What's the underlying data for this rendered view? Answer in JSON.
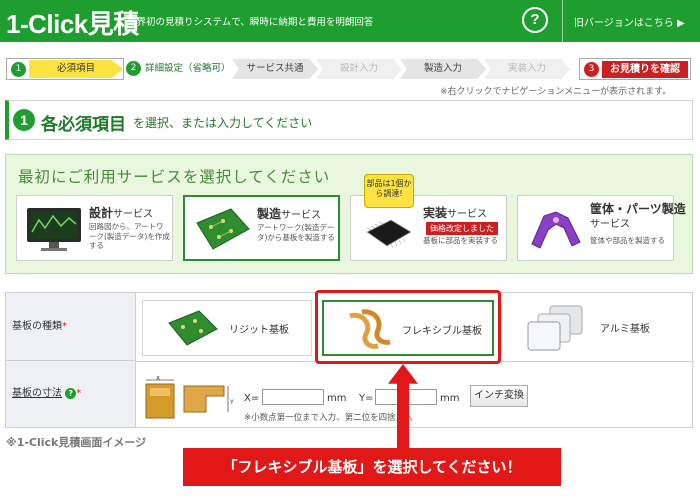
{
  "header": {
    "logo": "1-Click見積",
    "tagline": "業界初の見積りシステムで、瞬時に納期と費用を明朗回答",
    "help_label": "?",
    "old_version_link": "旧バージョンはこちら ▶"
  },
  "steps": {
    "step1_num": "1",
    "step1_label": "必須項目",
    "step2_num": "2",
    "step2_label": "詳細設定（省略可）",
    "tabs": [
      "サービス共通",
      "設計入力",
      "製造入力",
      "実装入力"
    ],
    "quote_num": "3",
    "quote_label": "お見積りを確認",
    "right_click_note": "※右クリックでナビゲーションメニューが表示されます。"
  },
  "section": {
    "num": "1",
    "title": "各必須項目",
    "subtitle": "を選択、または入力してください"
  },
  "services": {
    "heading": "最初にご利用サービスを選択してください",
    "items": [
      {
        "name": "設計",
        "suffix": "サービス",
        "desc": "回路図から、アートワーク(製造データ)を作成する"
      },
      {
        "name": "製造",
        "suffix": "サービス",
        "desc": "アートワーク(製造データ)から基板を製造する"
      },
      {
        "name": "実装",
        "suffix": "サービス",
        "desc": "基板に部品を実装する"
      },
      {
        "name": "筐体・パーツ製造",
        "suffix": "サービス",
        "desc": "筐体や部品を製造する"
      }
    ],
    "badge": "部品は1個から調達!",
    "price_tag": "価格改定しました"
  },
  "form": {
    "board_type_label": "基板の種類",
    "required_mark": "*",
    "boards": [
      "リジット基板",
      "フレキシブル基板",
      "アルミ基板"
    ],
    "size_label": "基板の寸法",
    "help_icon": "?",
    "x_label": "X=",
    "y_label": "Y=",
    "unit": "mm",
    "x_value": "",
    "y_value": "",
    "inch_button": "インチ変換",
    "note": "※小数点第一位まで入力、第二位を四捨五入",
    "dim_img_x": "X",
    "dim_img_y": "Y"
  },
  "caption": "※1-Click見積画面イメージ",
  "callout": "「フレキシブル基板」を選択してください！",
  "colors": {
    "brand_green": "#1e9e2e",
    "accent_red": "#e01818",
    "yellow": "#fde341"
  }
}
